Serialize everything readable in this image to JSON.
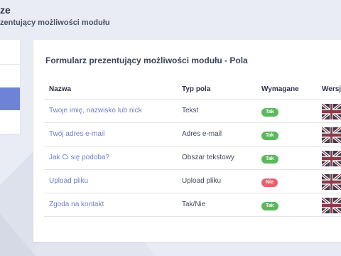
{
  "header": {
    "title": "ze",
    "subtitle": "zentujący możliwości modułu"
  },
  "panel": {
    "title": "Formularz prezentujący możliwości modułu - Pola"
  },
  "table": {
    "headers": {
      "name": "Nazwa",
      "type": "Typ pola",
      "required": "Wymagane",
      "version": "Wersj"
    },
    "rows": [
      {
        "name": "Twoje imię, nazwisko lub nick",
        "type": "Tekst",
        "required": "Tak",
        "required_color": "#5cb85c",
        "version_icon": "uk-flag-icon"
      },
      {
        "name": "Twój adres e-mail",
        "type": "Adres e-mail",
        "required": "Tak",
        "required_color": "#5cb85c",
        "version_icon": "uk-flag-icon"
      },
      {
        "name": "Jak Ci się podoba?",
        "type": "Obszar tekstowy",
        "required": "Tak",
        "required_color": "#5cb85c",
        "version_icon": "uk-flag-icon"
      },
      {
        "name": "Upload pliku",
        "type": "Upload pliku",
        "required": "Nie",
        "required_color": "#e8606e",
        "version_icon": "uk-flag-icon"
      },
      {
        "name": "Zgoda na kontakt",
        "type": "Tak/Nie",
        "required": "Tak",
        "required_color": "#5cb85c",
        "version_icon": "uk-flag-icon"
      }
    ]
  },
  "colors": {
    "accent": "#6e83d8",
    "link": "#6f7fc8",
    "yes": "#5cb85c",
    "no": "#e8606e"
  }
}
